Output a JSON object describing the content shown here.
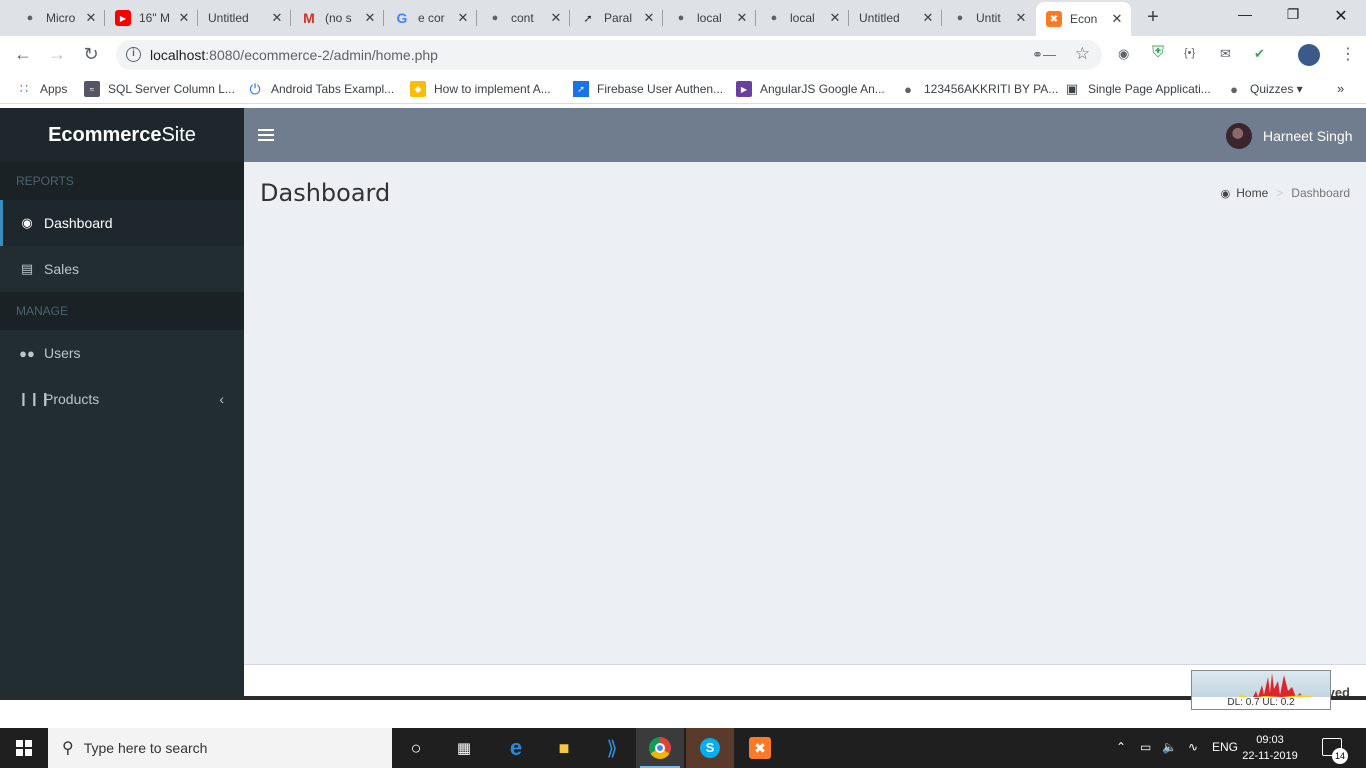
{
  "browser": {
    "tabs": [
      {
        "title": "Micro",
        "icon": "globe-icon",
        "active": false
      },
      {
        "title": "16\" M",
        "icon": "youtube-icon",
        "active": false
      },
      {
        "title": "Untitled",
        "icon": "",
        "active": false
      },
      {
        "title": "(no s",
        "icon": "gmail-icon",
        "active": false
      },
      {
        "title": "e cor",
        "icon": "google-icon",
        "active": false
      },
      {
        "title": "cont",
        "icon": "globe-icon",
        "active": false
      },
      {
        "title": "Paral",
        "icon": "parallel-icon",
        "active": false
      },
      {
        "title": "local",
        "icon": "globe-icon",
        "active": false
      },
      {
        "title": "local",
        "icon": "globe-icon",
        "active": false
      },
      {
        "title": "Untitled",
        "icon": "",
        "active": false
      },
      {
        "title": "Untit",
        "icon": "globe-icon",
        "active": false
      },
      {
        "title": "Econ",
        "icon": "xampp-icon",
        "active": true
      }
    ],
    "url_host": "localhost",
    "url_rest": ":8080/ecommerce-2/admin/home.php",
    "bookmarks": [
      {
        "label": "Apps",
        "icon": "apps-grid-icon"
      },
      {
        "label": "SQL Server Column L...",
        "icon": "sql-icon"
      },
      {
        "label": "Android Tabs Exampl...",
        "icon": "power-icon"
      },
      {
        "label": "How to implement A...",
        "icon": "firebase-icon"
      },
      {
        "label": "Firebase User Authen...",
        "icon": "link-icon"
      },
      {
        "label": "AngularJS Google An...",
        "icon": "video-icon"
      },
      {
        "label": "123456AKKRITI BY PA...",
        "icon": "globe-icon"
      },
      {
        "label": "Single Page Applicati...",
        "icon": "document-icon"
      },
      {
        "label": "Quizzes ▾",
        "icon": "globe-icon"
      }
    ]
  },
  "app": {
    "brand_bold": "Ecommerce",
    "brand_light": "Site",
    "user_name": "Harneet Singh",
    "sidebar": {
      "reports_header": "REPORTS",
      "manage_header": "MANAGE",
      "items": [
        {
          "label": "Dashboard",
          "icon": "dashboard-icon",
          "active": true
        },
        {
          "label": "Sales",
          "icon": "money-icon",
          "active": false
        },
        {
          "label": "Users",
          "icon": "users-icon",
          "active": false
        },
        {
          "label": "Products",
          "icon": "barcode-icon",
          "active": false
        }
      ]
    },
    "page_title": "Dashboard",
    "breadcrumb": {
      "home": "Home",
      "current": "Dashboard"
    },
    "footer_text": "ved"
  },
  "netmeter": {
    "label": "DL: 0.7 UL: 0.2"
  },
  "taskbar": {
    "search_placeholder": "Type here to search",
    "language": "ENG",
    "time": "09:03",
    "date": "22-11-2019",
    "notifications": "14"
  },
  "colors": {
    "sidebar_bg": "#222d32",
    "header_bg": "#707d8f",
    "content_bg": "#ecf0f5",
    "accent": "#3c8dbc"
  }
}
